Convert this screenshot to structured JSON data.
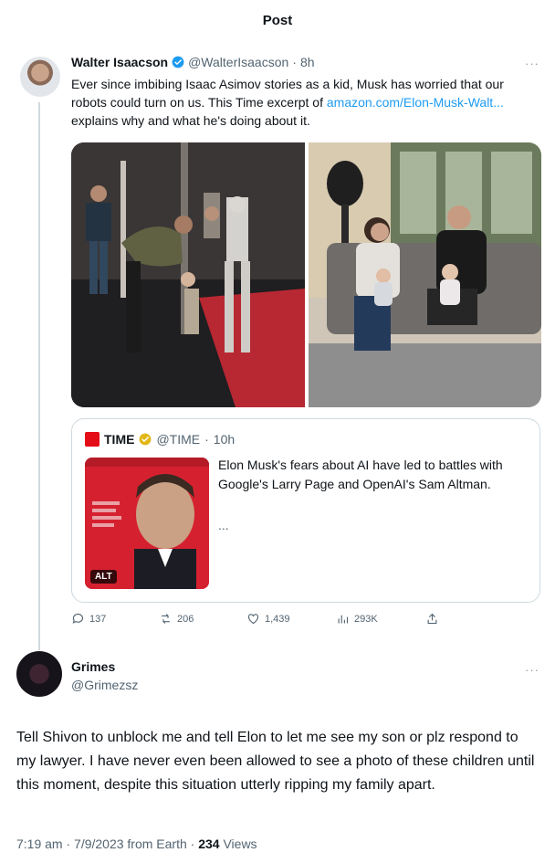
{
  "header": {
    "title": "Post"
  },
  "tweet": {
    "author_name": "Walter Isaacson",
    "author_handle": "@WalterIsaacson",
    "time": "8h",
    "text_before_link": "Ever since imbibing Isaac Asimov stories as a kid, Musk has worried that our robots could turn on us.  This Time excerpt of ",
    "link_text": "amazon.com/Elon-Musk-Walt...",
    "text_after_link": " explains why and what he's doing about it.",
    "verified_color": "#1d9bf0",
    "quote": {
      "name": "TIME",
      "handle": "@TIME",
      "time": "10h",
      "text": "Elon Musk's fears about AI have led to battles with Google's Larry Page and OpenAI's Sam Altman.",
      "more": "...",
      "image_alt_badge": "ALT",
      "brand_color": "#e40c17",
      "check_color": "#e2b719"
    },
    "actions": {
      "replies": "137",
      "reposts": "206",
      "likes": "1,439",
      "views": "293K"
    }
  },
  "reply": {
    "author_name": "Grimes",
    "author_handle": "@Grimezsz",
    "text": "Tell Shivon to unblock me and tell Elon to let me see my son or plz respond to my lawyer.  I have never even been allowed to see a photo of these children until this moment, despite this situation utterly ripping my family apart.",
    "footer_prefix": "7:19 am · 7/9/2023 from Earth · ",
    "views_count": "234",
    "views_label": " Views"
  },
  "icons": {
    "reply": "reply-icon",
    "repost": "repost-icon",
    "like": "heart-icon",
    "views": "analytics-icon",
    "share": "share-icon",
    "more": "more-icon",
    "verified": "verified-badge-icon"
  }
}
